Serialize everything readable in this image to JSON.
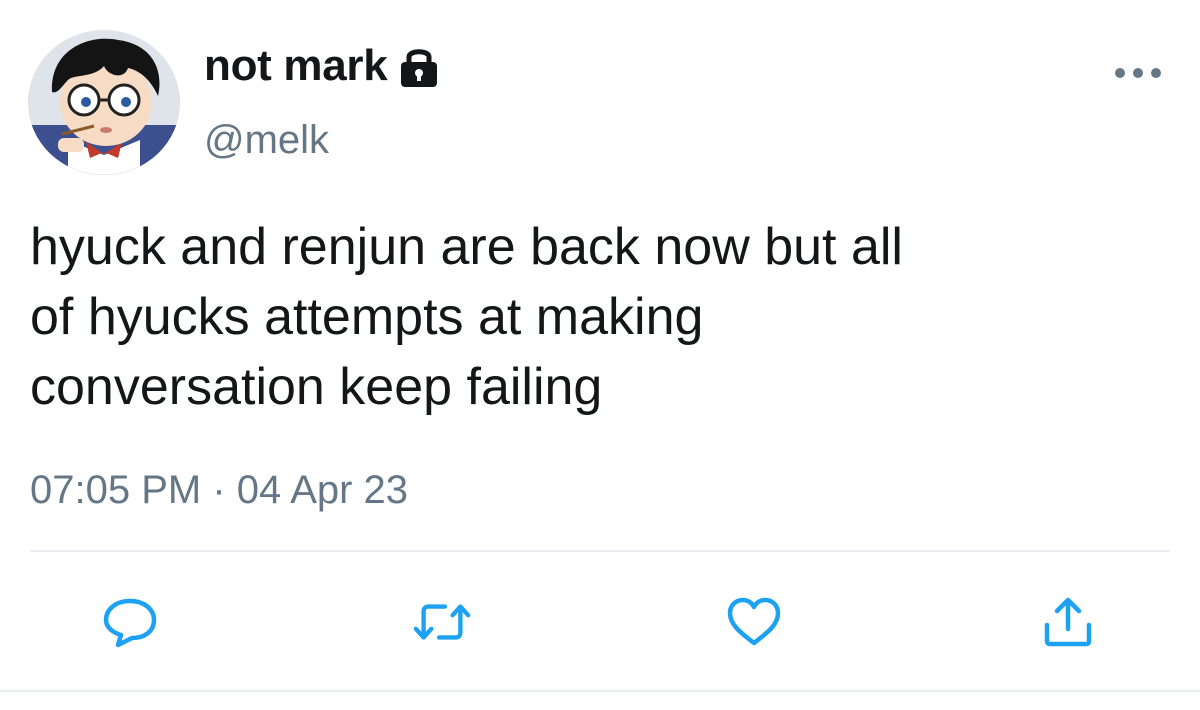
{
  "author": {
    "display_name": "not mark",
    "handle": "@melk",
    "protected": true,
    "avatar_icon": "avatar-cartoon-boy-with-glasses"
  },
  "tweet": {
    "text": "hyuck and renjun are back now but all\nof hyucks attempts at making\nconversation keep failing",
    "time": "07:05 PM",
    "separator": "·",
    "date": "04 Apr 23"
  },
  "icons": {
    "lock": "lock-icon",
    "more": "more-horizontal-icon",
    "reply": "reply-bubble-icon",
    "retweet": "retweet-icon",
    "like": "heart-icon",
    "share": "share-icon"
  },
  "colors": {
    "text_primary": "#14171a",
    "text_secondary": "#657786",
    "action_blue": "#1da1f2",
    "divider": "#e6ecf0"
  }
}
